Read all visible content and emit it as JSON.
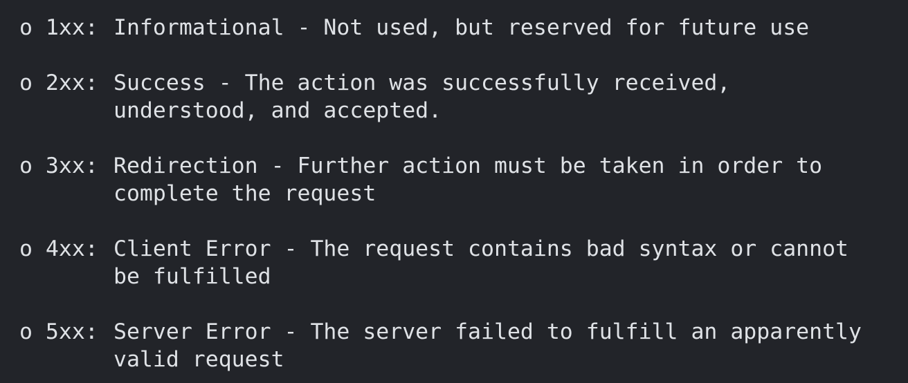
{
  "status_classes": [
    {
      "prefix": "o 1xx:",
      "lines": [
        "Informational - Not used, but reserved for future use"
      ]
    },
    {
      "prefix": "o 2xx:",
      "lines": [
        "Success - The action was successfully received,",
        "understood, and accepted."
      ]
    },
    {
      "prefix": "o 3xx:",
      "lines": [
        "Redirection - Further action must be taken in order to",
        "complete the request"
      ]
    },
    {
      "prefix": "o 4xx:",
      "lines": [
        "Client Error - The request contains bad syntax or cannot",
        "be fulfilled"
      ]
    },
    {
      "prefix": "o 5xx:",
      "lines": [
        "Server Error - The server failed to fulfill an apparently",
        "valid request"
      ]
    }
  ],
  "colors": {
    "background": "#222429",
    "text": "#dfe2e6"
  }
}
